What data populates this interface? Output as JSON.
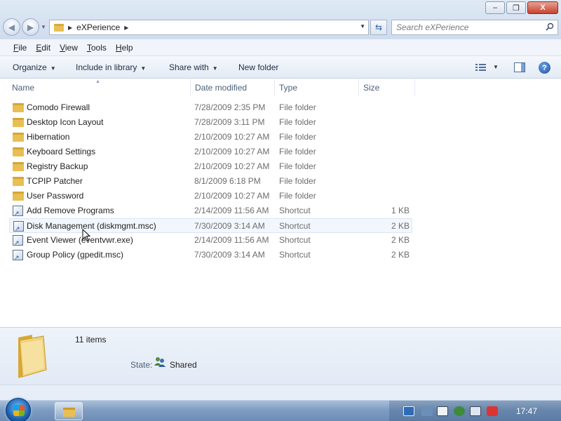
{
  "window": {
    "minimize_glyph": "–",
    "restore_glyph": "❐",
    "close_glyph": "X"
  },
  "address": {
    "crumb": "eXPerience"
  },
  "search": {
    "placeholder": "Search eXPerience"
  },
  "menu": {
    "items": [
      "File",
      "Edit",
      "View",
      "Tools",
      "Help"
    ]
  },
  "commands": {
    "organize": "Organize",
    "include_in_library": "Include in library",
    "share_with": "Share with",
    "new_folder": "New folder"
  },
  "columns": {
    "name": "Name",
    "date_modified": "Date modified",
    "type": "Type",
    "size": "Size"
  },
  "files": [
    {
      "name": "Comodo Firewall",
      "date": "7/28/2009 2:35 PM",
      "type": "File folder",
      "size": "",
      "icon": "folder-icon"
    },
    {
      "name": "Desktop Icon Layout",
      "date": "7/28/2009 3:11 PM",
      "type": "File folder",
      "size": "",
      "icon": "folder-icon"
    },
    {
      "name": "Hibernation",
      "date": "2/10/2009 10:27 AM",
      "type": "File folder",
      "size": "",
      "icon": "folder-icon"
    },
    {
      "name": "Keyboard Settings",
      "date": "2/10/2009 10:27 AM",
      "type": "File folder",
      "size": "",
      "icon": "folder-icon"
    },
    {
      "name": "Registry Backup",
      "date": "2/10/2009 10:27 AM",
      "type": "File folder",
      "size": "",
      "icon": "folder-icon"
    },
    {
      "name": "TCPIP Patcher",
      "date": "8/1/2009 6:18 PM",
      "type": "File folder",
      "size": "",
      "icon": "folder-icon"
    },
    {
      "name": "User Password",
      "date": "2/10/2009 10:27 AM",
      "type": "File folder",
      "size": "",
      "icon": "folder-icon"
    },
    {
      "name": "Add Remove Programs",
      "date": "2/14/2009 11:56 AM",
      "type": "Shortcut",
      "size": "1 KB",
      "icon": "shortcut-icon"
    },
    {
      "name": "Disk Management (diskmgmt.msc)",
      "date": "7/30/2009 3:14 AM",
      "type": "Shortcut",
      "size": "2 KB",
      "icon": "shortcut-icon"
    },
    {
      "name": "Event Viewer (eventvwr.exe)",
      "date": "2/14/2009 11:56 AM",
      "type": "Shortcut",
      "size": "2 KB",
      "icon": "shortcut-icon"
    },
    {
      "name": "Group Policy (gpedit.msc)",
      "date": "7/30/2009 3:14 AM",
      "type": "Shortcut",
      "size": "2 KB",
      "icon": "shortcut-icon"
    }
  ],
  "hover_row": 8,
  "details": {
    "count": "11 items",
    "state_label": "State:",
    "state_value": "Shared"
  },
  "taskbar": {
    "clock": "17:47"
  },
  "colors": {
    "accent": "#1e2d45",
    "taskbar": "#7f9dc2",
    "folder": "#e7bf54"
  }
}
